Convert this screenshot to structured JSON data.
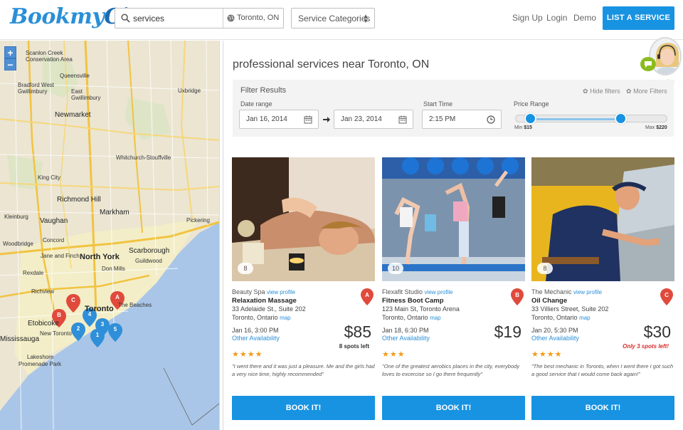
{
  "header": {
    "logo_part1": "Bookmy",
    "logo_part2": "City",
    "search_value": "services",
    "location": "Toronto, ON",
    "category_select": "Service Categories",
    "nav": [
      "Sign Up",
      "Login",
      "Demo"
    ],
    "cta": "LIST A SERVICE"
  },
  "map": {
    "zoom_in": "+",
    "zoom_out": "−",
    "towns": [
      "Scanlon Creek Conservation Area",
      "Queensville",
      "Bradford West Gwillimbury",
      "East Gwillimbury",
      "Uxbridge",
      "Newmarket",
      "Whitchurch-Stouffville",
      "King City",
      "Richmond Hill",
      "Markham",
      "Vaughan",
      "Pickering",
      "Kleinburg",
      "Concord",
      "Woodbridge",
      "Jane and Finch",
      "North York",
      "Scarborough",
      "Rexdale",
      "Don Mills",
      "Guildwood",
      "Richview",
      "Toronto",
      "The Beaches",
      "Etobicoke",
      "New Toronto",
      "Lakeshore",
      "Promenade Park",
      "Mississauga"
    ],
    "pins": [
      {
        "label": "C",
        "color": "#e04a3c"
      },
      {
        "label": "A",
        "color": "#e04a3c"
      },
      {
        "label": "B",
        "color": "#e04a3c"
      },
      {
        "label": "4",
        "color": "#2f8fd8"
      },
      {
        "label": "3",
        "color": "#2f8fd8"
      },
      {
        "label": "2",
        "color": "#2f8fd8"
      },
      {
        "label": "5",
        "color": "#2f8fd8"
      },
      {
        "label": "1",
        "color": "#2f8fd8"
      }
    ]
  },
  "main": {
    "title": "professional services near Toronto, ON",
    "online": "online"
  },
  "filters": {
    "title": "Filter Results",
    "hide": "Hide filters",
    "more": "More Filters",
    "date_label": "Date range",
    "date_from": "Jan 16, 2014",
    "date_to": "Jan 23, 2014",
    "time_label": "Start Time",
    "time_value": "2:15 PM",
    "price_label": "Price Range",
    "min_label": "Min",
    "min_value": "$15",
    "max_label": "Max",
    "max_value": "$220"
  },
  "cards": [
    {
      "photo_count": "8",
      "provider": "Beauty Spa",
      "view_profile": "view profile",
      "service": "Relaxation Massage",
      "address1": "33 Adelaide St., Suite 202",
      "address2": "Toronto, Ontario",
      "map_link": "map",
      "marker": "A",
      "date": "Jan 16, 3:00 PM",
      "availability": "Other Availability",
      "price": "$85",
      "spots": "8 spots left",
      "spots_urgent": false,
      "rating": "★★★★",
      "review": "\"I went there and it was just a pleasure. Me and the girls had a very nice time, highly recommended\"",
      "book": "BOOK IT!"
    },
    {
      "photo_count": "10",
      "provider": "Flexafit Studio",
      "view_profile": "view profile",
      "service": "Fitness Boot Camp",
      "address1": "123 Main St, Toronto Arena",
      "address2": "Toronto, Ontario",
      "map_link": "map",
      "marker": "B",
      "date": "Jan 18, 6:30 PM",
      "availability": "Other Availability",
      "price": "$19",
      "spots": "",
      "spots_urgent": false,
      "rating": "★★★",
      "review": "\"One of the greatest aerobics places in the city, everybody loves to excercise so I go there frequently\"",
      "book": "BOOK IT!"
    },
    {
      "photo_count": "8",
      "provider": "The Mechanic",
      "view_profile": "view profile",
      "service": "Oil Change",
      "address1": "33 Villiers Street, Suite 202",
      "address2": "Toronto, Ontario",
      "map_link": "map",
      "marker": "C",
      "date": "Jan 20, 5:30 PM",
      "availability": "Other Availability",
      "price": "$30",
      "spots": "Only 3 spots left!",
      "spots_urgent": true,
      "rating": "★★★★",
      "review": "\"The best mechanic in Toronto, when I went there I got such a good service that I would come back again!\"",
      "book": "BOOK IT!"
    }
  ],
  "colors": {
    "brand": "#2a8fd8",
    "button": "#1793e2",
    "marker": "#e04a3c",
    "star": "#f39a17",
    "online": "#8cbb1f"
  }
}
